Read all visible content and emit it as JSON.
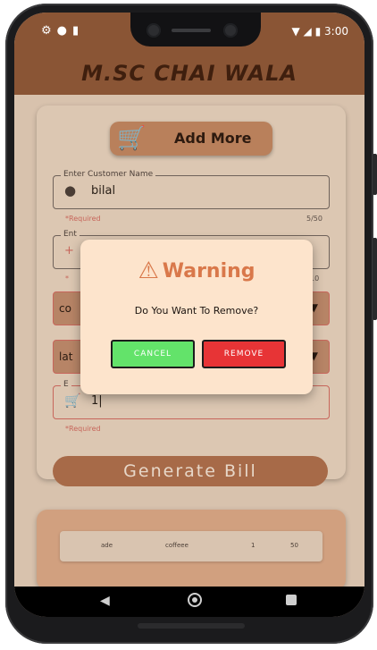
{
  "status_bar": {
    "left_icons": [
      "gear-icon",
      "circle-icon",
      "sd-card-icon"
    ],
    "right_icons": [
      "wifi-icon",
      "signal-icon",
      "battery-icon"
    ],
    "time": "3:00"
  },
  "app_bar": {
    "title": "M.SC CHAI WALA"
  },
  "form": {
    "add_more_label": "Add More",
    "customer_name": {
      "label": "Enter Customer Name",
      "value": "bilal",
      "helper": "*Required",
      "counter": "5/50"
    },
    "second_field": {
      "label": "Ent",
      "value": "+",
      "helper": "*",
      "counter": "10"
    },
    "dropdown_1": {
      "value": "co"
    },
    "dropdown_2": {
      "value": "lat"
    },
    "quantity_field": {
      "label": "E",
      "value": "1|",
      "helper": "*Required"
    },
    "generate_button_label": "Generate Bill"
  },
  "bill_row": {
    "cells": [
      "ade",
      "coffeee",
      "1",
      "50"
    ]
  },
  "dialog": {
    "title": "Warning",
    "message": "Do You Want To Remove?",
    "cancel_label": "CANCEL",
    "remove_label": "REMOVE"
  },
  "colors": {
    "app_bar": "#8a5535",
    "background": "#d8c2ad",
    "accent": "#d9784a",
    "cancel": "#63e36a",
    "remove": "#e73436"
  }
}
